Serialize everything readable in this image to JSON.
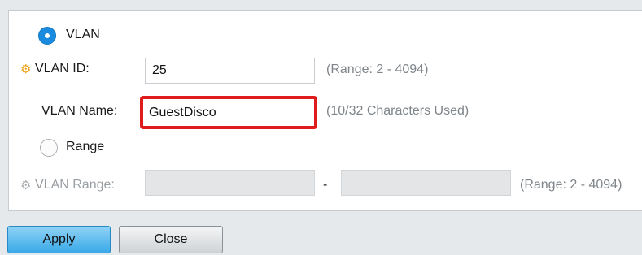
{
  "form": {
    "vlan_radio": {
      "label": "VLAN",
      "selected": true
    },
    "vlan_id": {
      "label": "VLAN ID:",
      "value": "25",
      "hint": "(Range: 2 - 4094)"
    },
    "vlan_name": {
      "label": "VLAN Name:",
      "value": "GuestDisco",
      "hint": "(10/32 Characters Used)"
    },
    "range_radio": {
      "label": "Range",
      "selected": false
    },
    "vlan_range": {
      "label": "VLAN Range:",
      "separator": "-",
      "start_value": "",
      "end_value": "",
      "hint": "(Range: 2 - 4094)"
    }
  },
  "footer": {
    "apply_label": "Apply",
    "close_label": "Close"
  },
  "colors": {
    "accent": "#1a8bde",
    "highlight": "#e01b1b",
    "required": "#f0a31a"
  },
  "icons": {
    "required": "gear-icon"
  }
}
